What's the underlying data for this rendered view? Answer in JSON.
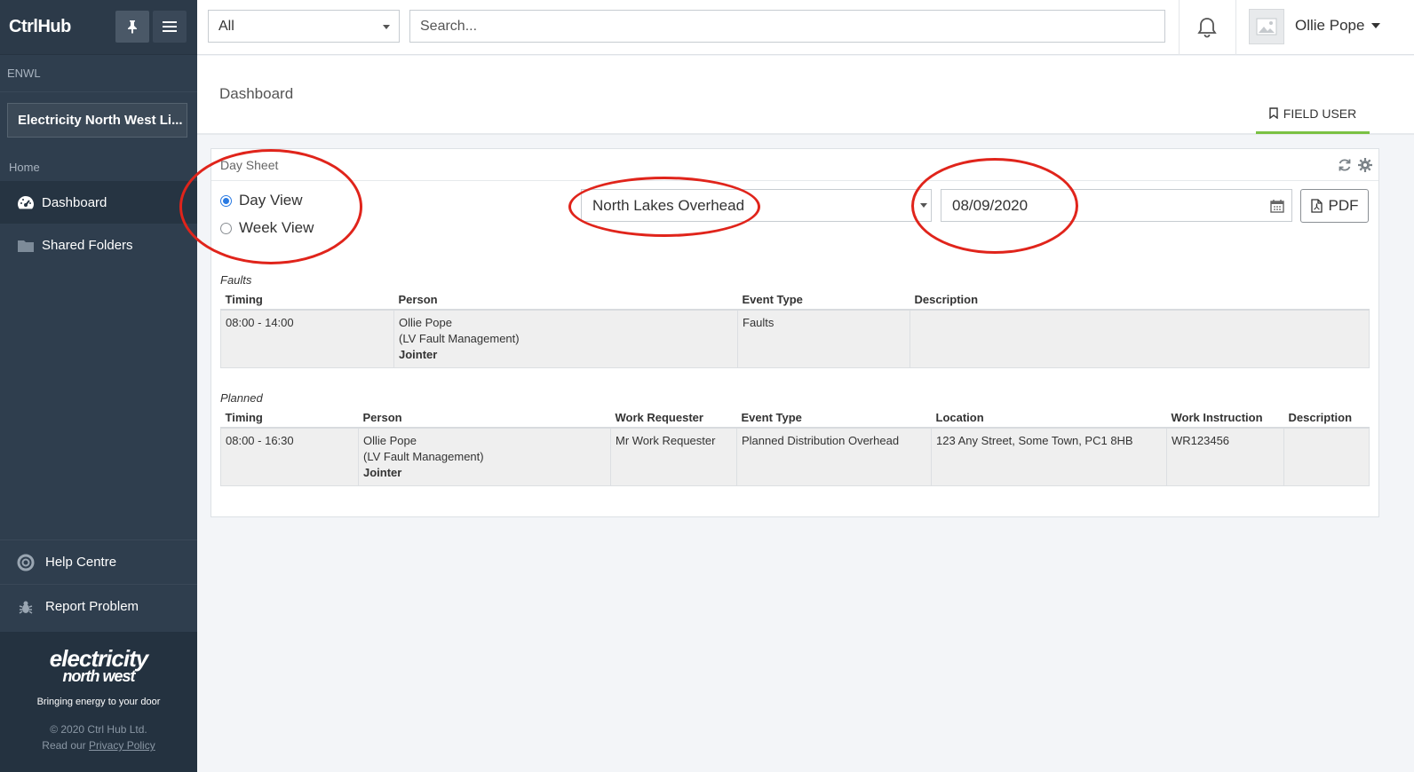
{
  "app": {
    "brand": "CtrlHub"
  },
  "sidebar": {
    "org_label": "ENWL",
    "org_name": "Electricity North West Li...",
    "home_label": "Home",
    "items": [
      {
        "label": "Dashboard",
        "icon": "dashboard-gauge-icon"
      },
      {
        "label": "Shared Folders",
        "icon": "folder-icon"
      }
    ],
    "bottom_items": [
      {
        "label": "Help Centre",
        "icon": "lifebuoy-icon"
      },
      {
        "label": "Report Problem",
        "icon": "bug-icon"
      }
    ],
    "footer": {
      "logo_line1": "electricity",
      "logo_line2": "north west",
      "tagline": "Bringing energy to your door",
      "copyright": "© 2020 Ctrl Hub Ltd.",
      "read_our": "Read our",
      "privacy_link": "Privacy Policy"
    }
  },
  "topbar": {
    "filter_value": "All",
    "search_placeholder": "Search...",
    "user_name": "Ollie Pope"
  },
  "page": {
    "title": "Dashboard",
    "tab_label": "FIELD USER",
    "accent_color": "#7ac143"
  },
  "panel": {
    "title": "Day Sheet",
    "view_options": [
      {
        "label": "Day View",
        "selected": true
      },
      {
        "label": "Week View",
        "selected": false
      }
    ],
    "team_value": "North Lakes Overhead",
    "date_value": "08/09/2020",
    "pdf_label": "PDF"
  },
  "faults": {
    "label": "Faults",
    "headers": [
      "Timing",
      "Person",
      "Event Type",
      "Description"
    ],
    "rows": [
      {
        "timing": "08:00 - 14:00",
        "person_name": "Ollie Pope",
        "person_dept": "(LV Fault Management)",
        "person_role": "Jointer",
        "event_type": "Faults",
        "description": ""
      }
    ]
  },
  "planned": {
    "label": "Planned",
    "headers": [
      "Timing",
      "Person",
      "Work Requester",
      "Event Type",
      "Location",
      "Work Instruction",
      "Description"
    ],
    "rows": [
      {
        "timing": "08:00 - 16:30",
        "person_name": "Ollie Pope",
        "person_dept": "(LV Fault Management)",
        "person_role": "Jointer",
        "work_requester": "Mr Work Requester",
        "event_type": "Planned Distribution Overhead",
        "location": "123 Any Street, Some Town, PC1 8HB",
        "work_instruction": "WR123456",
        "description": ""
      }
    ]
  },
  "annotation_color": "#e0241b"
}
